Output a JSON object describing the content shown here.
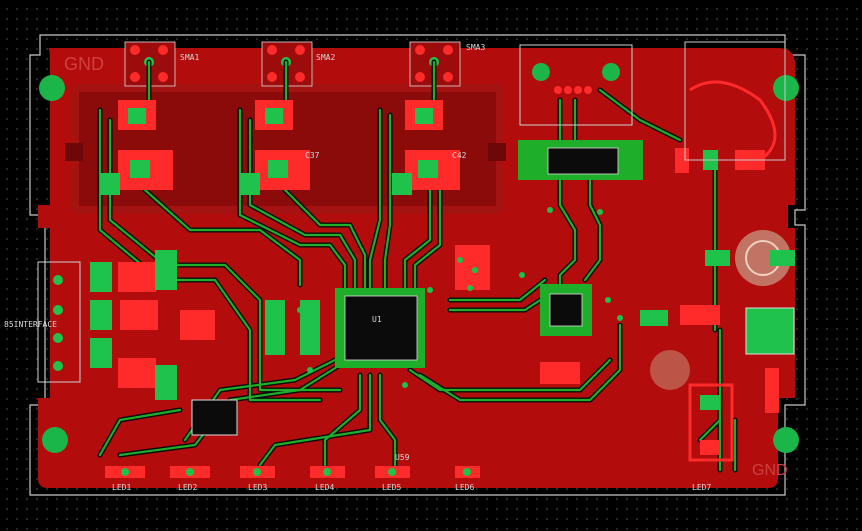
{
  "board": {
    "colors": {
      "background": "#000000",
      "copper": "#b20c0c",
      "copper_dark": "#8c0808",
      "trace": "#1fae2a",
      "trace_outline": "#0a0a0a",
      "pad": "#ff2a2a",
      "via": "#19c24a",
      "silkscreen": "#d0d0d0",
      "outline": "#c8c8c8"
    },
    "labels": {
      "sma1": "SMA1",
      "sma2": "SMA2",
      "sma3": "SMA3",
      "gnd_top": "GND",
      "gnd_bottom": "GND",
      "interface": "85INTERFACE",
      "u1": "U1",
      "u59": "U59",
      "c37": "C37",
      "c42": "C42",
      "led_row": [
        "LED1",
        "LED2",
        "LED3",
        "LED4",
        "LED5",
        "LED6",
        "LED7"
      ]
    }
  }
}
